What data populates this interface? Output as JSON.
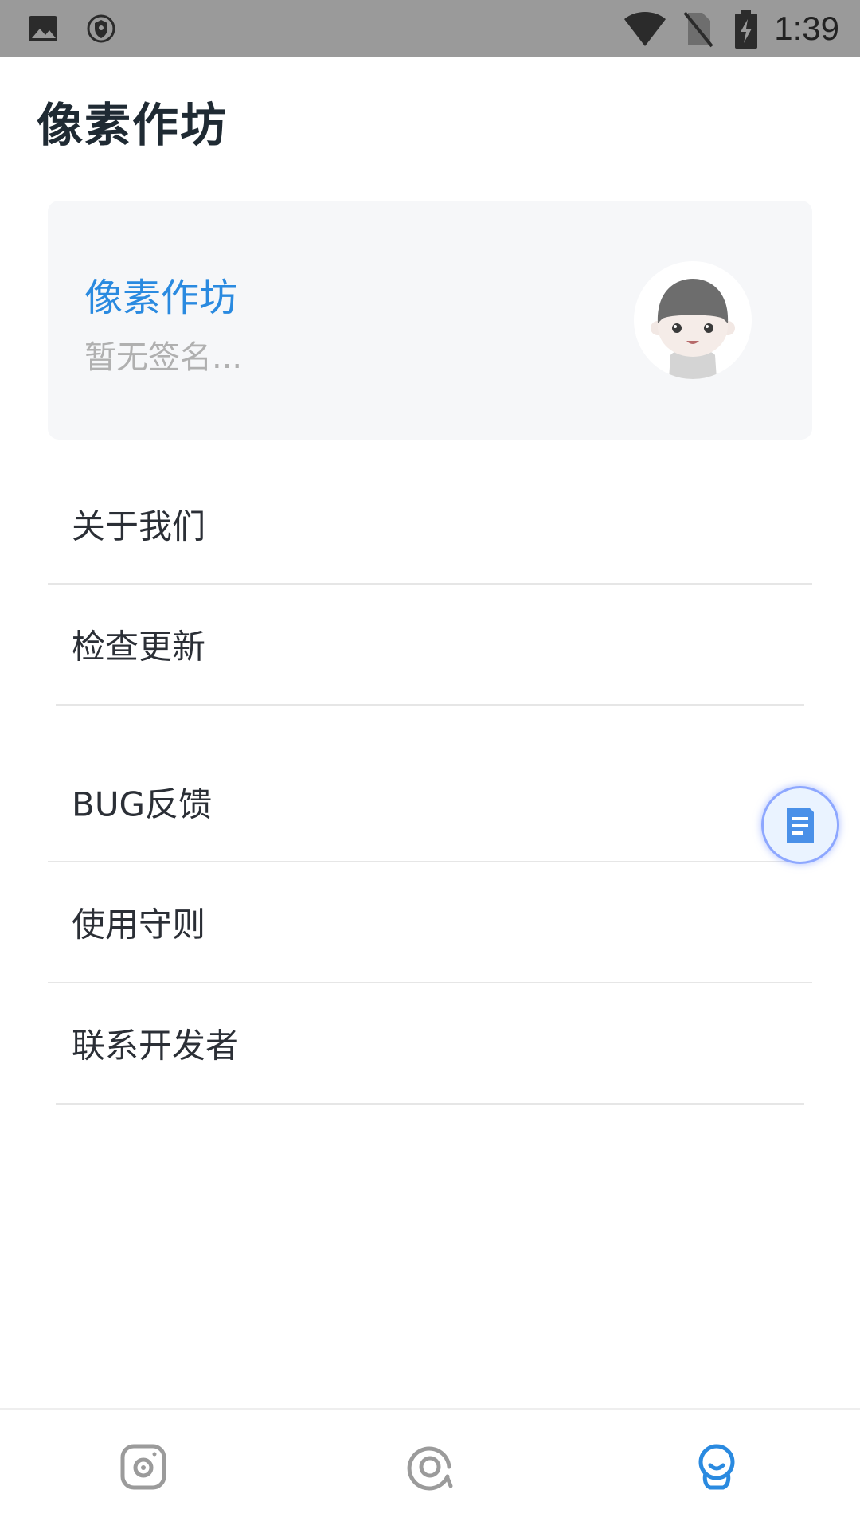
{
  "status_bar": {
    "time": "1:39",
    "icons": [
      "image-icon",
      "shield-icon",
      "wifi-icon",
      "no-sim-icon",
      "battery-charging-icon"
    ]
  },
  "page": {
    "title": "像素作坊"
  },
  "profile": {
    "name": "像素作坊",
    "signature": "暂无签名...",
    "avatar_icon": "avatar-icon"
  },
  "menu": {
    "items": [
      {
        "label": "关于我们"
      },
      {
        "label": "检查更新"
      },
      {
        "label": "BUG反馈"
      },
      {
        "label": "使用守则"
      },
      {
        "label": "联系开发者"
      }
    ]
  },
  "fab": {
    "icon": "document-icon"
  },
  "bottom_nav": {
    "tabs": [
      {
        "icon": "camera-icon",
        "active": false
      },
      {
        "icon": "discover-icon",
        "active": false
      },
      {
        "icon": "profile-icon",
        "active": true
      }
    ]
  },
  "colors": {
    "accent": "#2a8ae0",
    "status_bar": "#9a9a9a",
    "card_bg": "#f6f7f9",
    "inactive_icon": "#9b9b9b",
    "title": "#1f2a33"
  }
}
